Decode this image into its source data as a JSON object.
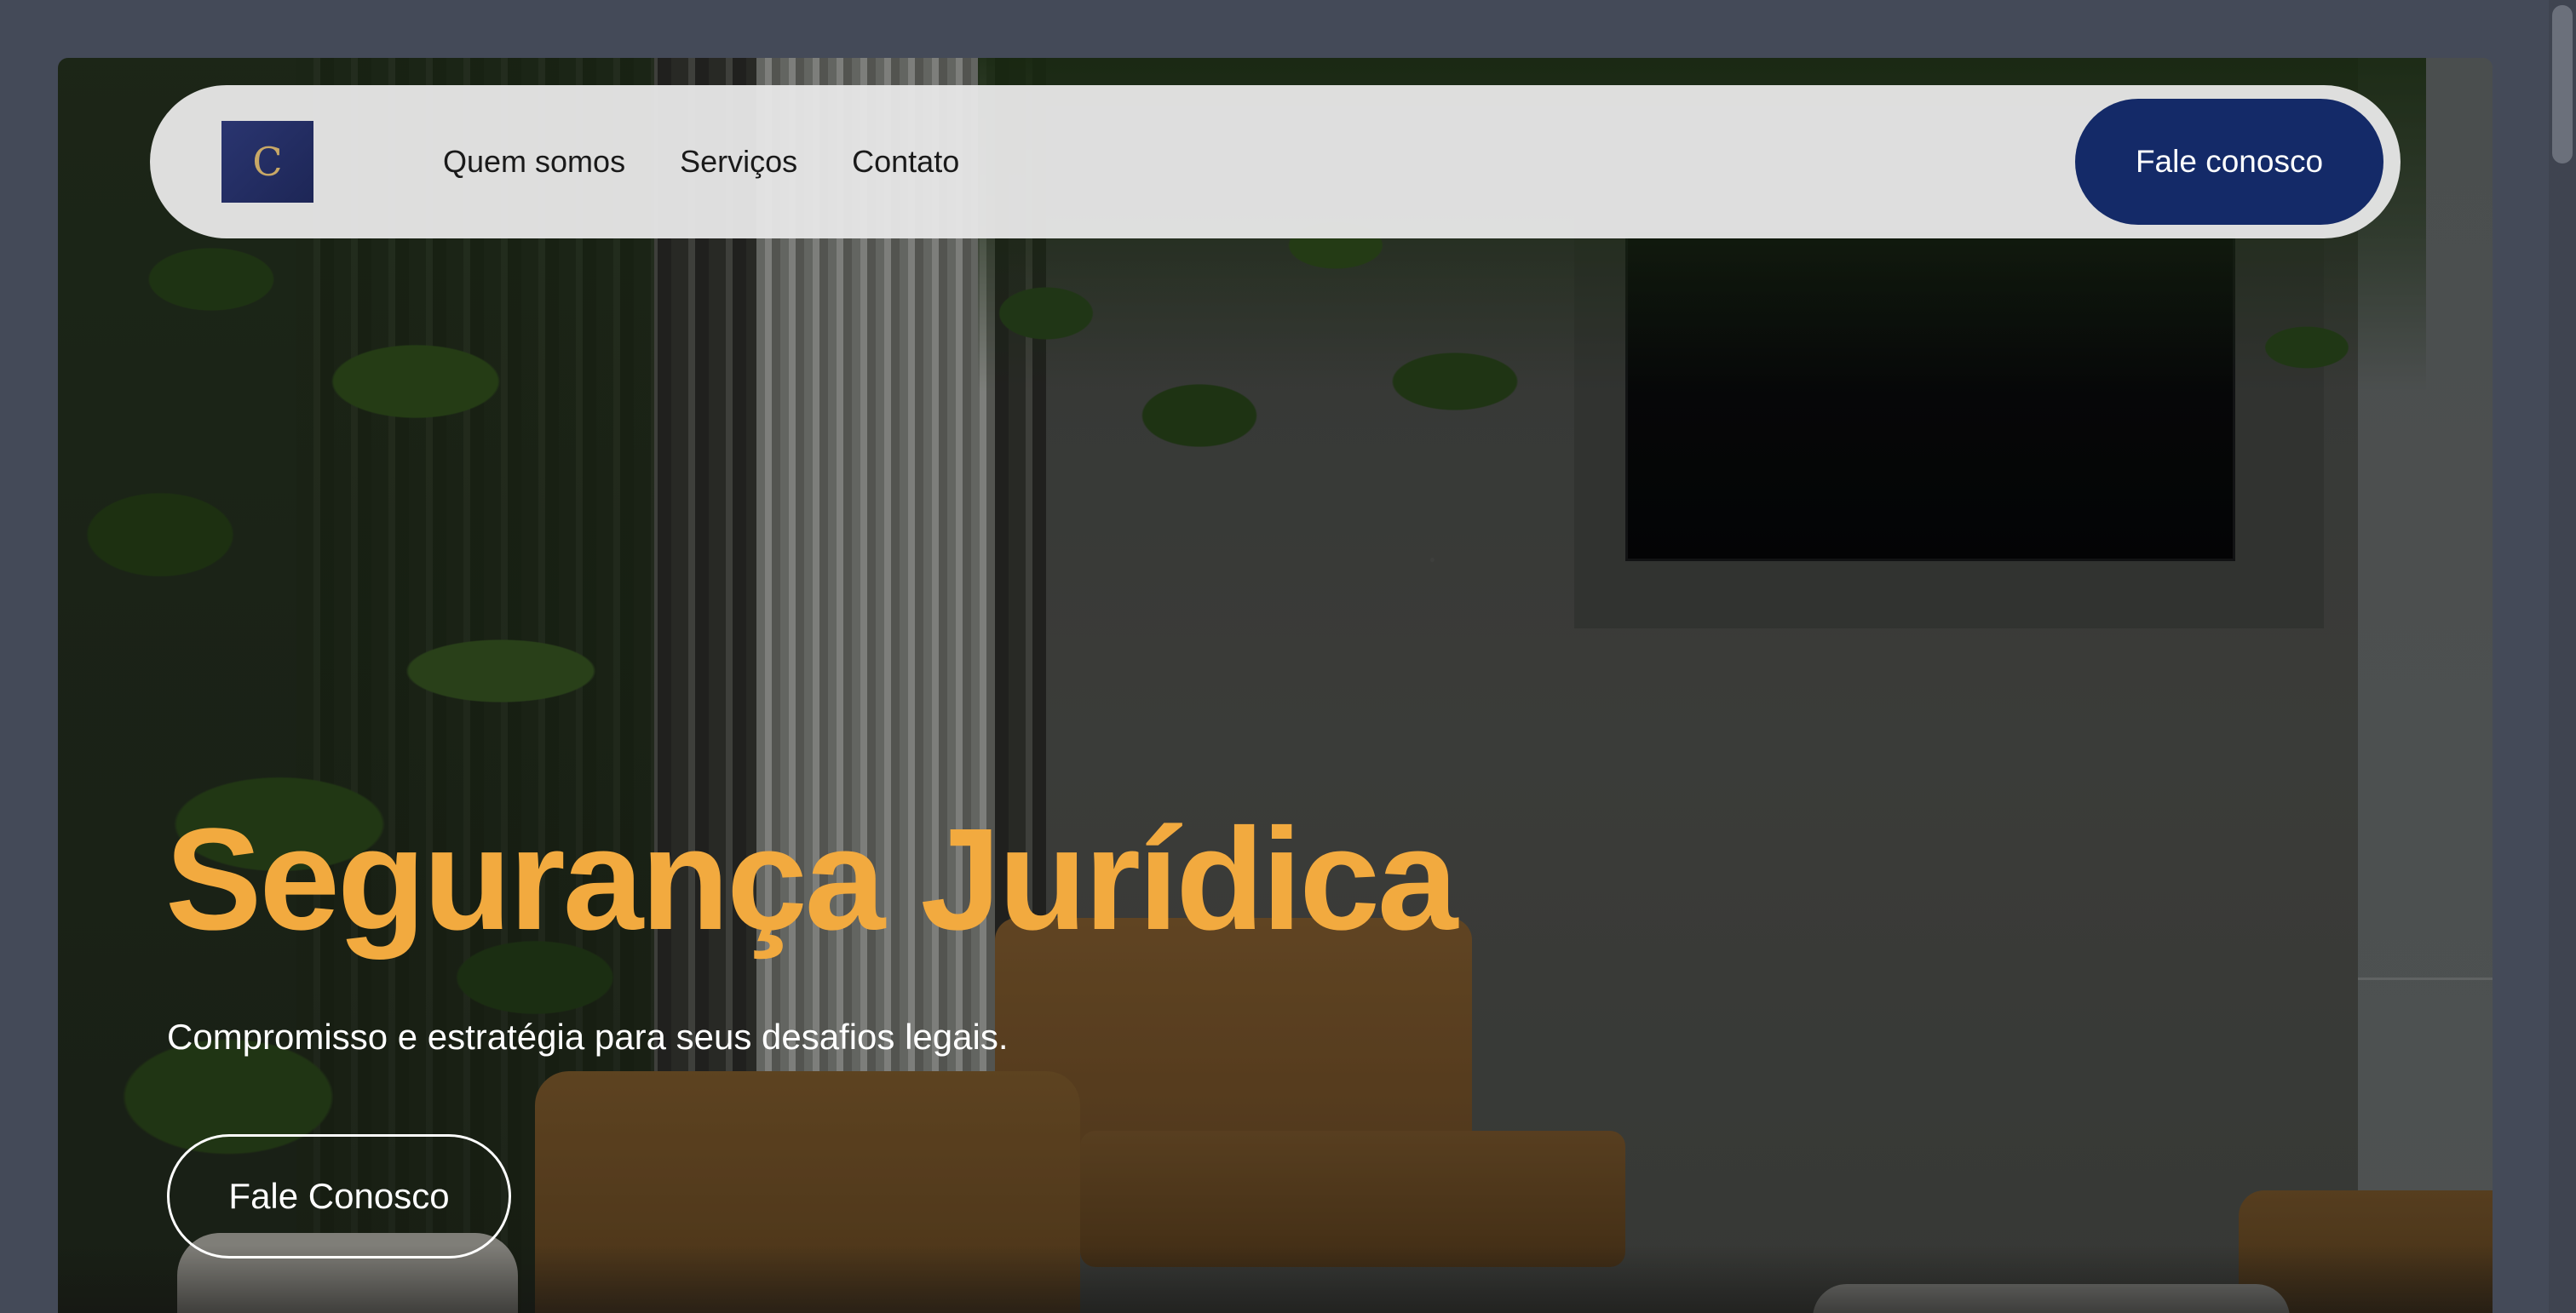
{
  "nav": {
    "logo_letter": "C",
    "links": [
      "Quem somos",
      "Serviços",
      "Contato"
    ],
    "cta_label": "Fale conosco"
  },
  "hero": {
    "title": "Segurança Jurídica",
    "subtitle": "Compromisso e estratégia para seus desafios legais.",
    "button_label": "Fale Conosco"
  },
  "colors": {
    "page_bg": "#444a58",
    "nav_bg": "#e6e6e6",
    "brand_navy": "#142a68",
    "accent_gold": "#f2aa3f",
    "text_light": "#ffffff"
  },
  "icons": {
    "logo": "monogram-c-logo"
  }
}
